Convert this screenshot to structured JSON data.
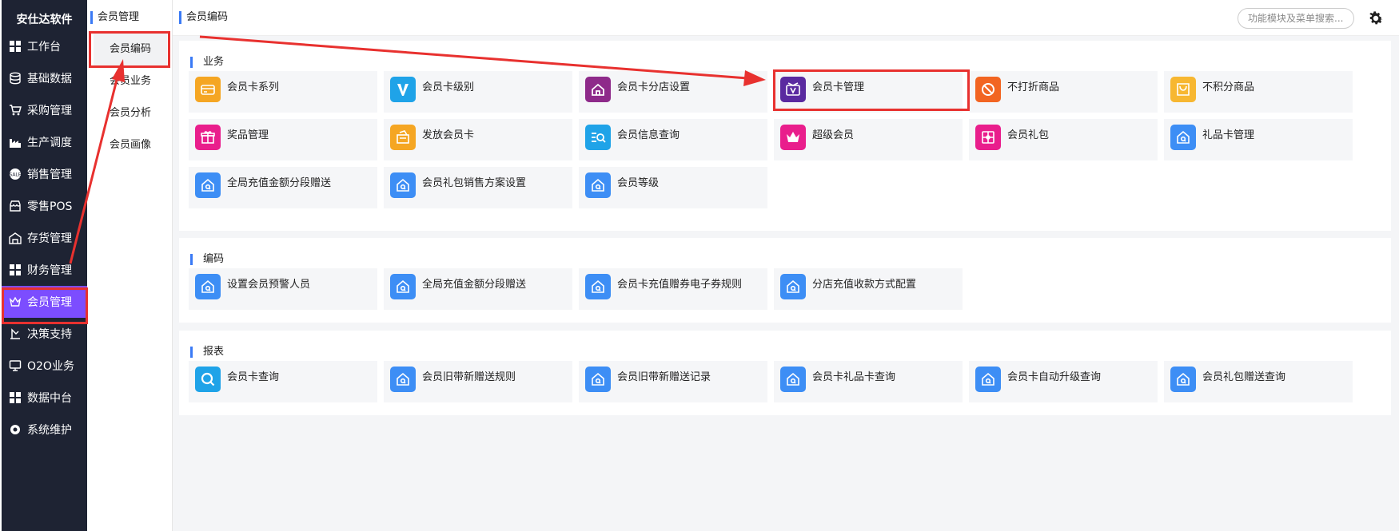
{
  "sidebar": {
    "brand": "安仕达软件",
    "items": [
      {
        "label": "工作台",
        "icon": "grid-icon"
      },
      {
        "label": "基础数据",
        "icon": "database-icon"
      },
      {
        "label": "采购管理",
        "icon": "cart-icon"
      },
      {
        "label": "生产调度",
        "icon": "factory-icon"
      },
      {
        "label": "销售管理",
        "icon": "sales-icon"
      },
      {
        "label": "零售POS",
        "icon": "store-icon"
      },
      {
        "label": "存货管理",
        "icon": "warehouse-icon"
      },
      {
        "label": "财务管理",
        "icon": "grid-icon"
      },
      {
        "label": "会员管理",
        "icon": "crown-icon",
        "active": true
      },
      {
        "label": "决策支持",
        "icon": "decision-icon"
      },
      {
        "label": "O2O业务",
        "icon": "monitor-icon"
      },
      {
        "label": "数据中台",
        "icon": "grid-icon"
      },
      {
        "label": "系统维护",
        "icon": "gear-icon"
      }
    ]
  },
  "subnav": {
    "title": "会员管理",
    "items": [
      "会员编码",
      "会员业务",
      "会员分析",
      "会员画像"
    ]
  },
  "header": {
    "breadcrumb": "会员编码",
    "search_placeholder": "功能模块及菜单搜索..."
  },
  "sections": [
    {
      "title": "业务",
      "cards": [
        {
          "label": "会员卡系列",
          "color": "#f5a623",
          "icon": "card-icon"
        },
        {
          "label": "会员卡级别",
          "color": "#1fa3e8",
          "icon": "v-logo-icon"
        },
        {
          "label": "会员卡分店设置",
          "color": "#8e2a8a",
          "icon": "house-icon"
        },
        {
          "label": "会员卡管理",
          "color": "#5a2aa0",
          "icon": "vip-card-icon"
        },
        {
          "label": "不打折商品",
          "color": "#f26522",
          "icon": "ban-icon"
        },
        {
          "label": "不积分商品",
          "color": "#f7b731",
          "icon": "bag-icon"
        },
        {
          "label": "奖品管理",
          "color": "#e91e8c",
          "icon": "gift-icon"
        },
        {
          "label": "发放会员卡",
          "color": "#f5a623",
          "icon": "issue-card-icon"
        },
        {
          "label": "会员信息查询",
          "color": "#1fa3e8",
          "icon": "search-list-icon"
        },
        {
          "label": "超级会员",
          "color": "#e91e8c",
          "icon": "crown-icon"
        },
        {
          "label": "会员礼包",
          "color": "#e91e8c",
          "icon": "gift-box-icon"
        },
        {
          "label": "礼品卡管理",
          "color": "#3d8ef5",
          "icon": "home-q-icon"
        },
        {
          "label": "全局充值金额分段赠送",
          "color": "#3d8ef5",
          "icon": "home-q-icon"
        },
        {
          "label": "会员礼包销售方案设置",
          "color": "#3d8ef5",
          "icon": "home-q-icon"
        },
        {
          "label": "会员等级",
          "color": "#3d8ef5",
          "icon": "home-q-icon"
        }
      ]
    },
    {
      "title": "编码",
      "cards": [
        {
          "label": "设置会员预警人员",
          "color": "#3d8ef5",
          "icon": "home-q-icon"
        },
        {
          "label": "全局充值金额分段赠送",
          "color": "#3d8ef5",
          "icon": "home-q-icon"
        },
        {
          "label": "会员卡充值赠券电子券规则",
          "color": "#3d8ef5",
          "icon": "home-q-icon"
        },
        {
          "label": "分店充值收款方式配置",
          "color": "#3d8ef5",
          "icon": "home-q-icon"
        }
      ]
    },
    {
      "title": "报表",
      "cards": [
        {
          "label": "会员卡查询",
          "color": "#1fa3e8",
          "icon": "search-icon"
        },
        {
          "label": "会员旧带新赠送规则",
          "color": "#3d8ef5",
          "icon": "home-q-icon"
        },
        {
          "label": "会员旧带新赠送记录",
          "color": "#3d8ef5",
          "icon": "home-q-icon"
        },
        {
          "label": "会员卡礼品卡查询",
          "color": "#3d8ef5",
          "icon": "home-q-icon"
        },
        {
          "label": "会员卡自动升级查询",
          "color": "#3d8ef5",
          "icon": "home-q-icon"
        },
        {
          "label": "会员礼包赠送查询",
          "color": "#3d8ef5",
          "icon": "home-q-icon"
        }
      ]
    }
  ],
  "annotation_color": "#e8312f"
}
